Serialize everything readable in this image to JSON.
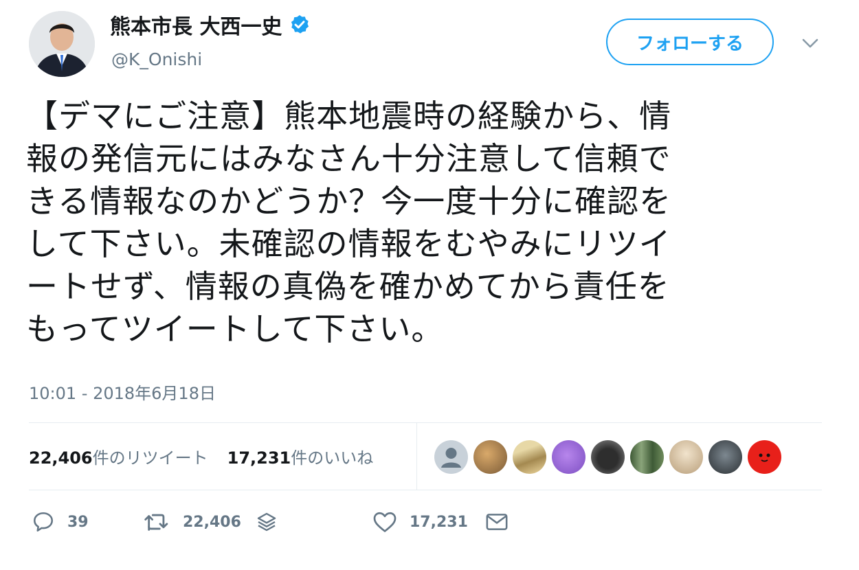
{
  "author": {
    "display_name": "熊本市長 大西一史",
    "handle": "@K_Onishi",
    "verified_icon": "verified-badge-icon",
    "avatar_icon": "profile-photo"
  },
  "follow_button": {
    "label": "フォローする"
  },
  "menu": {
    "icon": "chevron-down-icon"
  },
  "tweet": {
    "text": "【デマにご注意】熊本地震時の経験から、情\n報の発信元にはみなさん十分注意して信頼で\nきる情報なのかどうか？今一度十分に確認を\nして下さい。未確認の情報をむやみにリツイ\nートせず、情報の真偽を確かめてから責任を\nもってツイートして下さい。",
    "timestamp": "10:01 - 2018年6月18日"
  },
  "stats": {
    "retweets_count": "22,406",
    "retweets_label": "件のリツイート",
    "likes_count": "17,231",
    "likes_label": "件のいいね"
  },
  "likers": [
    {
      "icon": "default-avatar-icon",
      "color": "#c8d1d9"
    },
    {
      "icon": "liker-avatar",
      "color": "#a8845a"
    },
    {
      "icon": "liker-avatar",
      "color": "#c9b27a"
    },
    {
      "icon": "liker-avatar",
      "color": "#9b6bd6"
    },
    {
      "icon": "liker-avatar",
      "color": "#4a4a4a"
    },
    {
      "icon": "liker-avatar",
      "color": "#5f7a52"
    },
    {
      "icon": "liker-avatar",
      "color": "#d8c8b0"
    },
    {
      "icon": "liker-avatar",
      "color": "#556066"
    },
    {
      "icon": "liker-avatar",
      "color": "#e8201a"
    }
  ],
  "actions": {
    "reply_count": "39",
    "retweet_count": "22,406",
    "like_count": "17,231"
  },
  "colors": {
    "accent": "#1da1f2",
    "text": "#14171a",
    "secondary_text": "#657786",
    "divider": "#e6ecf0"
  }
}
